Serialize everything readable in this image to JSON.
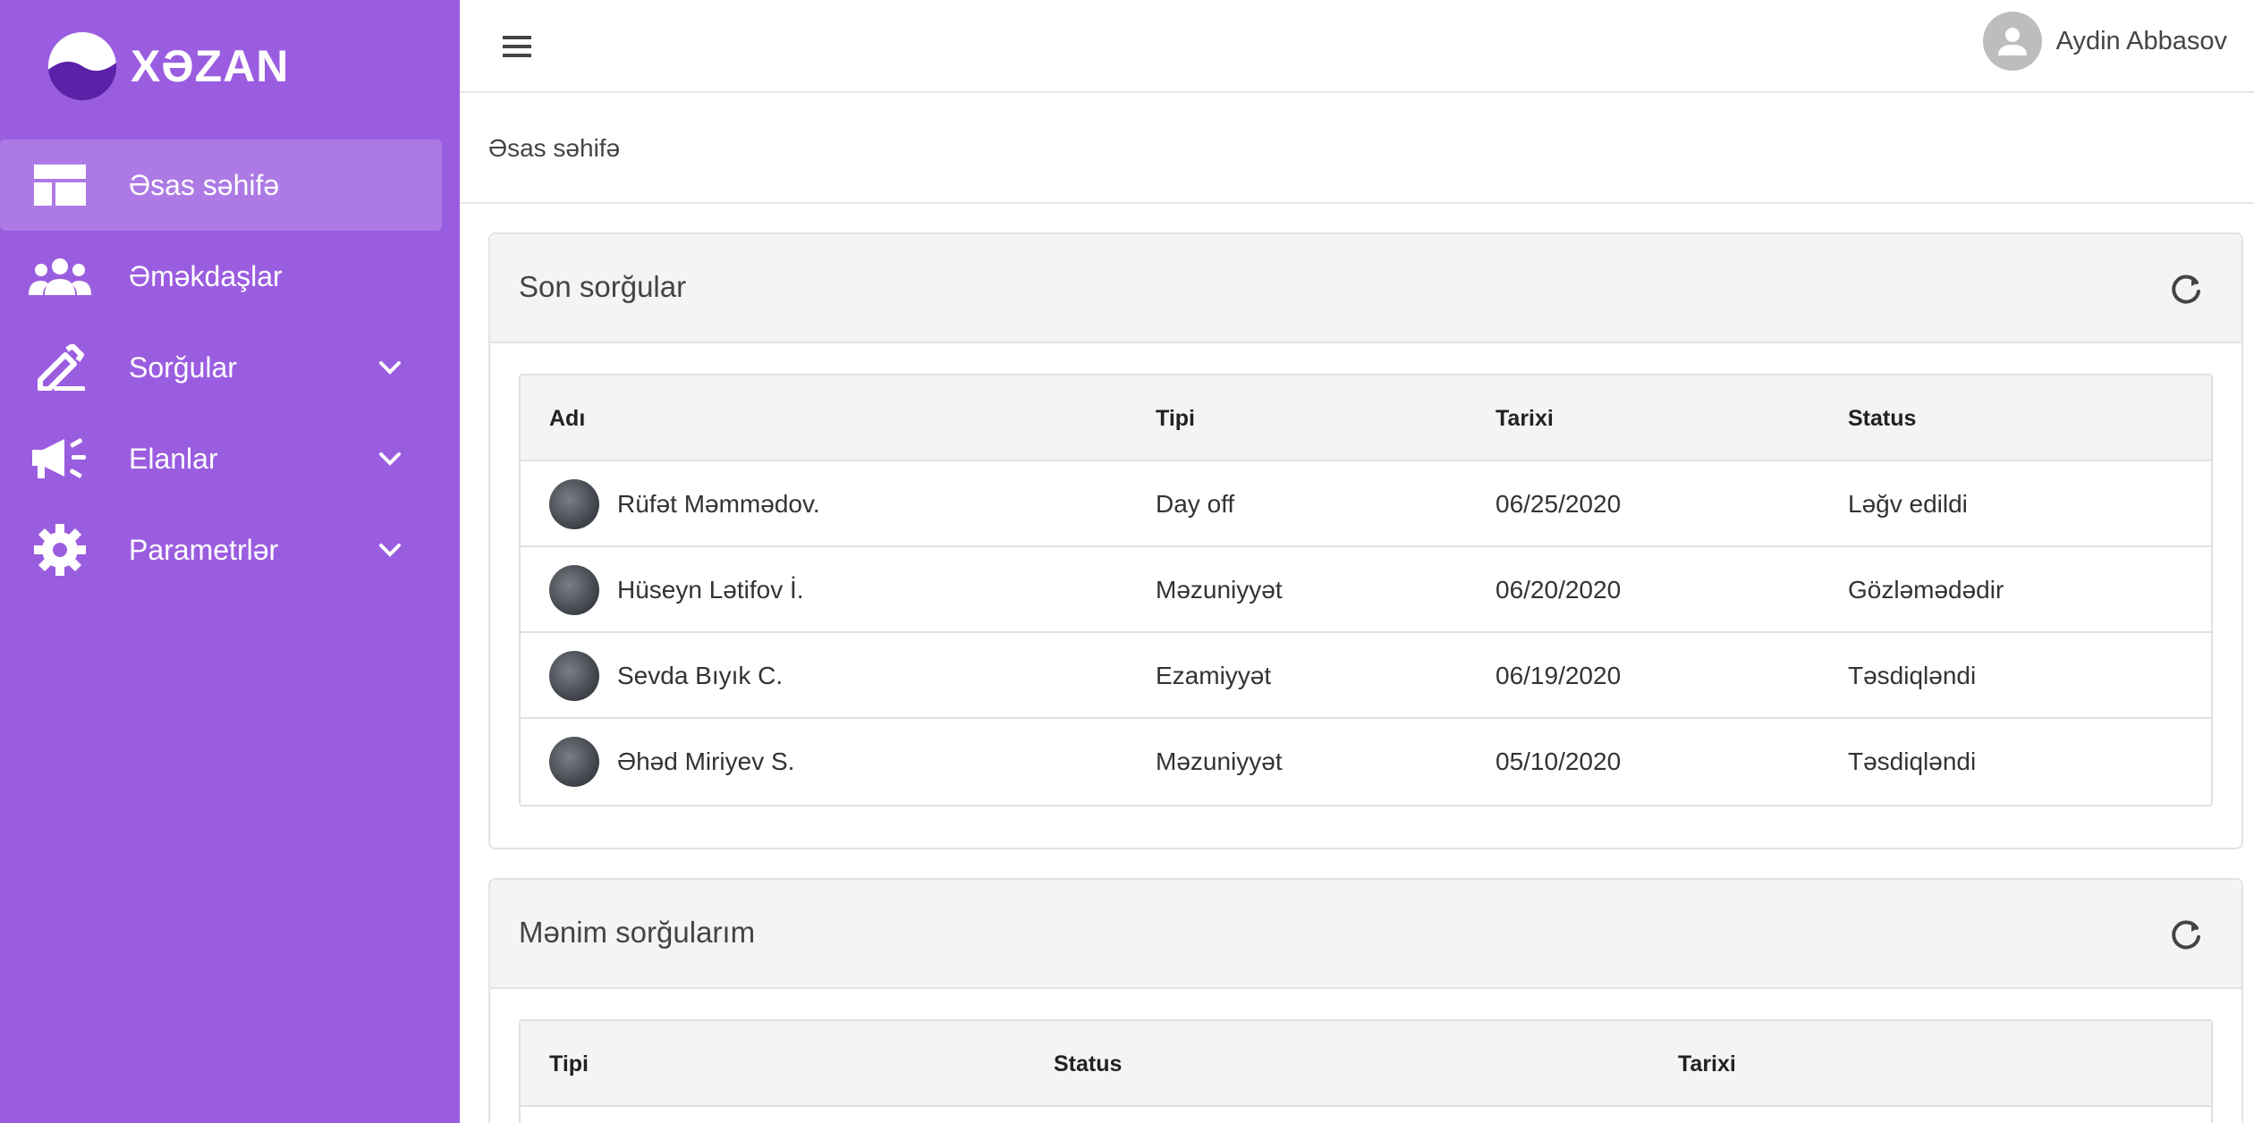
{
  "brand": {
    "name": "XƏZAN"
  },
  "sidebar": {
    "items": [
      {
        "label": "Əsas səhifə",
        "icon": "dashboard-icon",
        "active": true
      },
      {
        "label": "Əməkdaşlar",
        "icon": "people-icon"
      },
      {
        "label": "Sorğular",
        "icon": "edit-icon",
        "expandable": true
      },
      {
        "label": "Elanlar",
        "icon": "megaphone-icon",
        "expandable": true
      },
      {
        "label": "Parametrlər",
        "icon": "gear-icon",
        "expandable": true
      }
    ]
  },
  "header": {
    "user_name": "Aydin Abbasov"
  },
  "breadcrumb": "Əsas səhifə",
  "recent_requests": {
    "title": "Son sorğular",
    "columns": [
      "Adı",
      "Tipi",
      "Tarixi",
      "Status"
    ],
    "rows": [
      {
        "name": "Rüfət Məmmədov.",
        "type": "Day off",
        "date": "06/25/2020",
        "status": "Ləğv edildi"
      },
      {
        "name": "Hüseyn Lətifov İ.",
        "type": "Məzuniyyət",
        "date": "06/20/2020",
        "status": "Gözləmədədir"
      },
      {
        "name": "Sevda Bıyık C.",
        "type": "Ezamiyyət",
        "date": "06/19/2020",
        "status": "Təsdiqləndi"
      },
      {
        "name": "Əhəd Miriyev S.",
        "type": "Məzuniyyət",
        "date": "05/10/2020",
        "status": "Təsdiqləndi"
      }
    ]
  },
  "my_requests": {
    "title": "Mənim sorğularım",
    "columns": [
      "Tipi",
      "Status",
      "Tarixi"
    ]
  },
  "colors": {
    "sidebar": "#9b5de0",
    "header_bg": "#f4f4f4"
  }
}
